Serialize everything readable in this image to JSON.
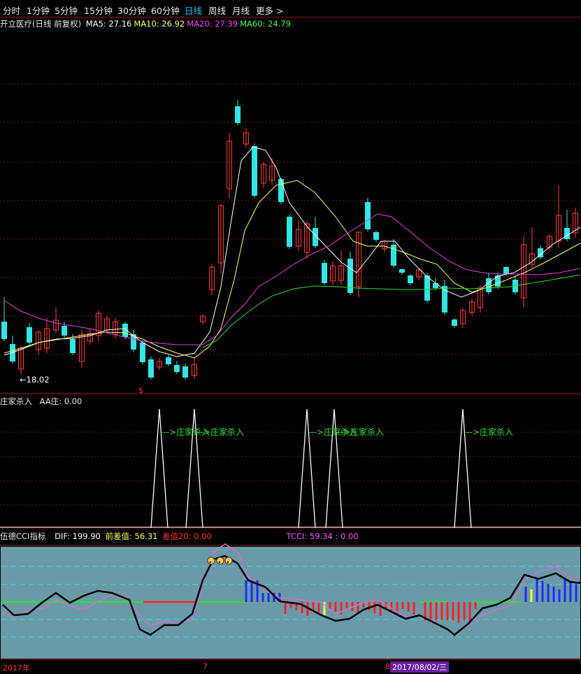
{
  "toolbar": {
    "tabs": [
      "分时",
      "1分钟",
      "5分钟",
      "15分钟",
      "30分钟",
      "60分钟",
      "日线",
      "周线",
      "月线",
      "更多 >"
    ],
    "active_index": 6
  },
  "main_panel": {
    "stock_label": "开立医疗(日线 前复权)",
    "ma_items": [
      {
        "label": "MA5: 27.16",
        "color": "#ffffff"
      },
      {
        "label": "MA10: 26.92",
        "color": "#ffff66"
      },
      {
        "label": "MA20: 27.39",
        "color": "#ff44ff"
      },
      {
        "label": "MA60: 24.79",
        "color": "#44ff44"
      }
    ],
    "low_marker": "←18.02",
    "signal_marker": "$"
  },
  "panel2": {
    "title": "庄家杀入",
    "value_label": "AA庄: 0.00",
    "signal_text": "--->庄家杀入",
    "signals": [
      {
        "label": "--->庄家杀入"
      },
      {
        "label": "--->庄家杀入"
      },
      {
        "label": "--->庄家杀入"
      },
      {
        "label": "--->庄家杀入"
      },
      {
        "label": "--->庄家杀入"
      }
    ]
  },
  "panel3": {
    "title": "伍德CCI指标",
    "dif": "DIF: 199.90",
    "prev_diff": "前差值: 56.31",
    "diff20": "差值20: 0.00",
    "tcci": "TCCI: 59.34 : 0.00",
    "colors": {
      "dif": "#ffffff",
      "prev_diff": "#ffff55",
      "diff20": "#ff3333",
      "tcci": "#ff55ff"
    }
  },
  "timeline": {
    "year_label": "2017年",
    "month_label": "7",
    "cursor_label": "8",
    "date_label": "2017/08/02/三"
  },
  "colors": {
    "up": "#ff3a3a",
    "down": "#33e6e6",
    "ma5": "#ffffff",
    "ma10": "#ffff66",
    "ma20": "#e040e0",
    "ma60": "#33dd33"
  }
}
